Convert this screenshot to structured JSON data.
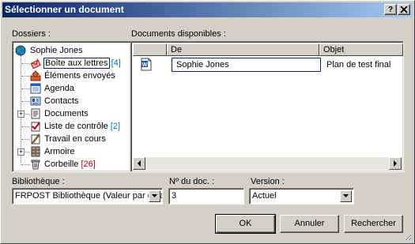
{
  "window": {
    "title": "Sélectionner un document",
    "help_button": "?",
    "close_button": "✕"
  },
  "folders": {
    "label": "Dossiers :",
    "items": [
      {
        "label": "Sophie Jones",
        "count": "",
        "icon": "globe-icon"
      },
      {
        "label": "Boîte aux lettres",
        "count": "[4]",
        "icon": "mailbox-icon"
      },
      {
        "label": "Éléments envoyés",
        "count": "",
        "icon": "sent-items-icon"
      },
      {
        "label": "Agenda",
        "count": "",
        "icon": "calendar-icon"
      },
      {
        "label": "Contacts",
        "count": "",
        "icon": "contacts-icon"
      },
      {
        "label": "Documents",
        "count": "",
        "icon": "documents-icon"
      },
      {
        "label": "Liste de contrôle",
        "count": "[2]",
        "icon": "checklist-icon"
      },
      {
        "label": "Travail en cours",
        "count": "",
        "icon": "work-in-progress-icon"
      },
      {
        "label": "Armoire",
        "count": "",
        "icon": "cabinet-icon"
      },
      {
        "label": "Corbeille",
        "count": "[26]",
        "icon": "trash-icon"
      }
    ]
  },
  "documents": {
    "label": "Documents disponibles :",
    "columns": [
      "De",
      "Objet"
    ],
    "rows": [
      {
        "from": "Sophie Jones",
        "subject": "Plan de test final"
      }
    ]
  },
  "library": {
    "label": "Bibliothèque :",
    "value": "FRPOST Bibliothèque  (Valeur par défaut)"
  },
  "doc_number": {
    "label": "Nº du doc. :",
    "value": "3"
  },
  "version": {
    "label": "Version :",
    "value": "Actuel"
  },
  "buttons": {
    "ok": "OK",
    "cancel": "Annuler",
    "search": "Rechercher"
  },
  "colors": {
    "title_start": "#0a246a",
    "title_end": "#a6caf0",
    "count_blue": "#0078c0",
    "count_red": "#c00000"
  }
}
